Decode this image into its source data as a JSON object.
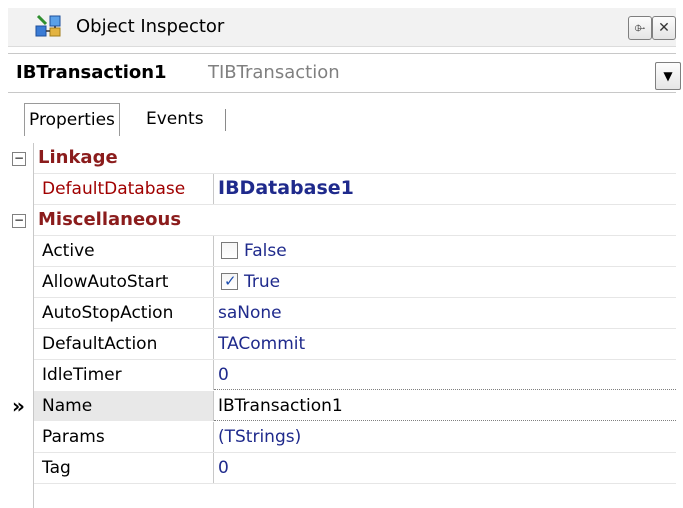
{
  "window": {
    "title": "Object Inspector",
    "pin_glyph": "⌱",
    "close_glyph": "✕",
    "icon": "object-inspector-icon"
  },
  "selector": {
    "component_name": "IBTransaction1",
    "component_type": "TIBTransaction",
    "dropdown_glyph": "▼"
  },
  "tabs": [
    {
      "label": "Properties",
      "active": true
    },
    {
      "label": "Events",
      "active": false
    }
  ],
  "grid": {
    "categories": [
      {
        "label": "Linkage",
        "expander": "−"
      },
      {
        "label": "Miscellaneous",
        "expander": "−"
      }
    ],
    "linkage_props": [
      {
        "name": "DefaultDatabase",
        "value": "IBDatabase1"
      }
    ],
    "misc_props": [
      {
        "name": "Active",
        "value": "False",
        "checked": false
      },
      {
        "name": "AllowAutoStart",
        "value": "True",
        "checked": true
      },
      {
        "name": "AutoStopAction",
        "value": "saNone"
      },
      {
        "name": "DefaultAction",
        "value": "TACommit"
      },
      {
        "name": "IdleTimer",
        "value": "0"
      },
      {
        "name": "Name",
        "value": "IBTransaction1",
        "selected": true
      },
      {
        "name": "Params",
        "value": "(TStrings)"
      },
      {
        "name": "Tag",
        "value": "0"
      }
    ],
    "selected_indicator": "»",
    "check_mark": "✓"
  },
  "colors": {
    "category_text": "#8b1c1c",
    "value_text": "#1f2a8c",
    "linked_name": "#a00000"
  }
}
